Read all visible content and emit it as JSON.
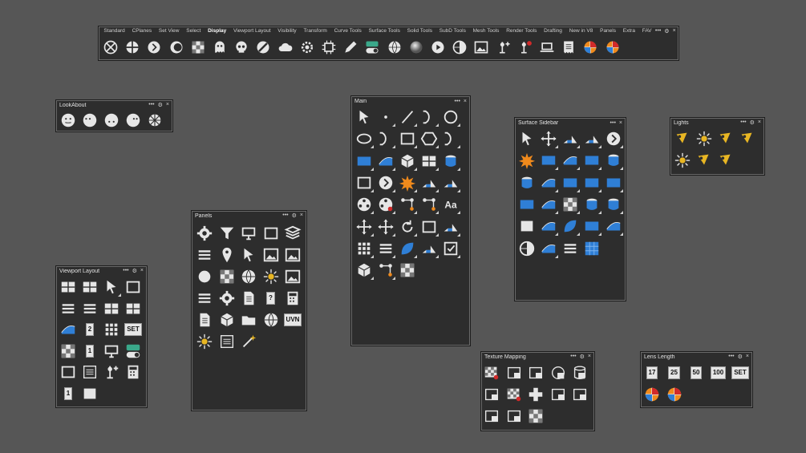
{
  "toolbar": {
    "tabs": [
      "Standard",
      "CPlanes",
      "Set View",
      "Select",
      "Display",
      "Viewport Layout",
      "Visibility",
      "Transform",
      "Curve Tools",
      "Surface Tools",
      "Solid Tools",
      "SubD Tools",
      "Mesh Tools",
      "Render Tools",
      "Drafting",
      "New in V8",
      "Panels",
      "Extra",
      "FAV"
    ],
    "active_tab": "Display",
    "icons": [
      "wireframe-display-icon",
      "shaded-display-icon",
      "rendered-display-icon",
      "ghosted-display-icon",
      "xray-display-icon",
      "technical-display-icon",
      "artistic-display-icon",
      "pen-display-icon",
      "arctic-display-icon",
      "monochrome-display-icon",
      "raytraced-display-icon",
      "settings-display-icon",
      "pen-edit-icon",
      "toggle-display-icon",
      "globe-grid-icon",
      "sphere-gradient-icon",
      "play-icon",
      "contrast-icon",
      "picture-icon",
      "light-add-icon",
      "light-remove-icon",
      "monitor-icon",
      "receipt-icon",
      "color-wheel-icon",
      "color-wheel-alt-icon"
    ]
  },
  "panels": {
    "lookabout": {
      "title": "LookAbout",
      "icons": [
        "look-face-icon",
        "look-face-left-icon",
        "look-face-down-icon",
        "look-face-right-icon",
        "look-center-icon"
      ]
    },
    "viewport_layout": {
      "title": "Viewport Layout"
    },
    "panels": {
      "title": "Panels"
    },
    "main": {
      "title": "Main"
    },
    "surface_sidebar": {
      "title": "Surface Sidebar"
    },
    "lights": {
      "title": "Lights"
    },
    "texture_mapping": {
      "title": "Texture Mapping"
    },
    "lens_length": {
      "title": "Lens Length",
      "buttons": [
        "17",
        "25",
        "50",
        "100",
        "SET"
      ]
    },
    "panel_text_icon": "?",
    "uvn_label": "UVN",
    "aa_label": "Aa",
    "set_label": "SET",
    "number_badge": "1",
    "number_badge_2": "2"
  },
  "controls": {
    "menu": "•••",
    "gear": "⚙",
    "close": "×"
  },
  "colors": {
    "background": "#565656",
    "panel": "#2d2d2d",
    "accent_blue": "#2f7fd6",
    "accent_orange": "#f08a1c",
    "accent_yellow": "#e8b623",
    "accent_red": "#d12a2a"
  }
}
